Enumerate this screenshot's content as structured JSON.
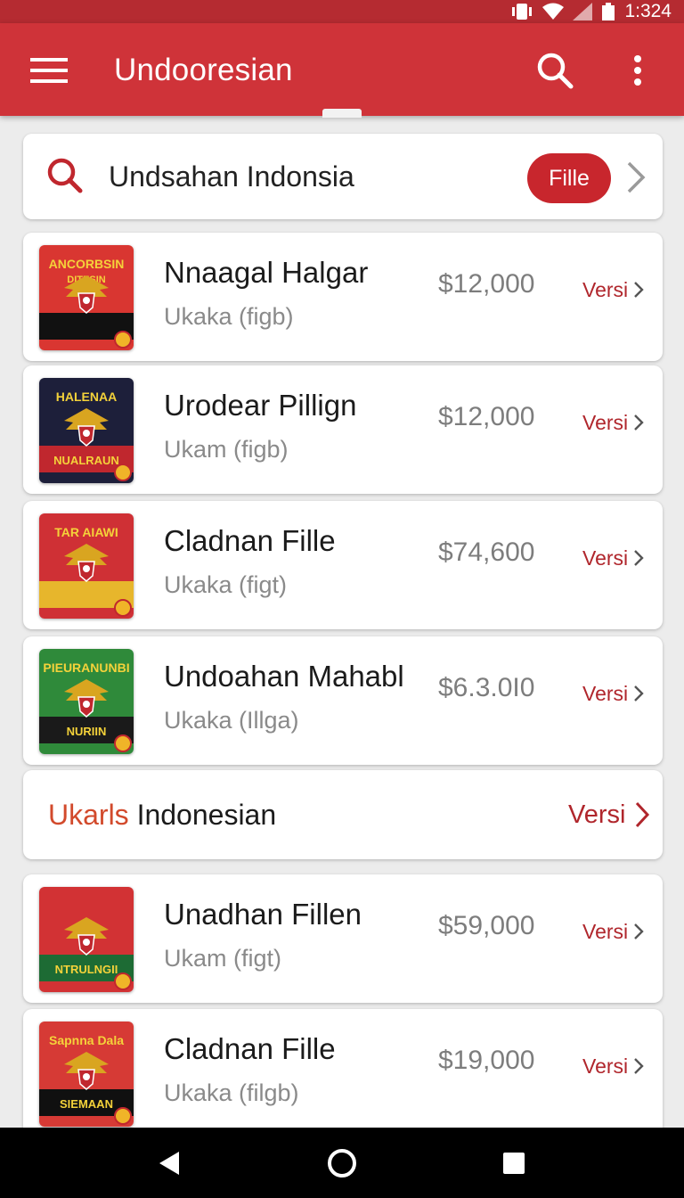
{
  "status": {
    "time": "1:324"
  },
  "app_bar": {
    "title": "Undooresian"
  },
  "search": {
    "query": "Undsahan Indonsia",
    "filter_label": "Fille"
  },
  "items": [
    {
      "title": "Nnaagal Halgar",
      "subtitle": "Ukaka (figb)",
      "price": "$12,000",
      "link": "Versi",
      "thumb": {
        "top": "ANCORBSIN",
        "mid": "DITESIN",
        "bottom": "",
        "bg": "#d93631",
        "band": "#111111"
      }
    },
    {
      "title": "Urodear Pillign",
      "subtitle": "Ukam (figb)",
      "price": "$12,000",
      "link": "Versi",
      "thumb": {
        "top": "HALENAA",
        "mid": "",
        "bottom": "NUALRAUN",
        "bg": "#1d1f3a",
        "band": "#c0272e"
      }
    },
    {
      "title": "Cladnan Fille",
      "subtitle": "Ukaka (figt)",
      "price": "$74,600",
      "link": "Versi",
      "thumb": {
        "top": "TAR AIAWI",
        "mid": "",
        "bottom": "",
        "bg": "#cf3035",
        "band": "#e7b62c"
      }
    },
    {
      "title": "Undoahan Mahabl",
      "subtitle": "Ukaka (Illga)",
      "price": "$6.3.0I0",
      "link": "Versi",
      "thumb": {
        "top": "PIEURANUNBI",
        "mid": "",
        "bottom": "NURIIN",
        "bg": "#2f8a3a",
        "band": "#1a1a1a"
      }
    }
  ],
  "section": {
    "accent": "Ukarls",
    "title": "Indonesian",
    "link": "Versi"
  },
  "items2": [
    {
      "title": "Unadhan Fillen",
      "subtitle": "Ukam (figt)",
      "price": "$59,000",
      "link": "Versi",
      "thumb": {
        "top": "",
        "mid": "",
        "bottom": "NTRULNGII",
        "bg": "#d23234",
        "band": "#1d6b34"
      }
    },
    {
      "title": "Cladnan Fille",
      "subtitle": "Ukaka (filgb)",
      "price": "$19,000",
      "link": "Versi",
      "thumb": {
        "top": "Sapnna Dala",
        "mid": "",
        "bottom": "SIEMAAN",
        "bg": "#d63a35",
        "band": "#101010"
      }
    }
  ],
  "colors": {
    "primary": "#cf3339",
    "primary_dark": "#b52b31",
    "accent_red": "#b0262c",
    "section_accent": "#d24a2c"
  },
  "icons": {
    "menu": "menu-icon",
    "search": "search-icon",
    "more": "more-vert-icon",
    "chevron": "chevron-right-icon",
    "back": "back-icon",
    "home": "home-icon",
    "recents": "recents-icon"
  }
}
